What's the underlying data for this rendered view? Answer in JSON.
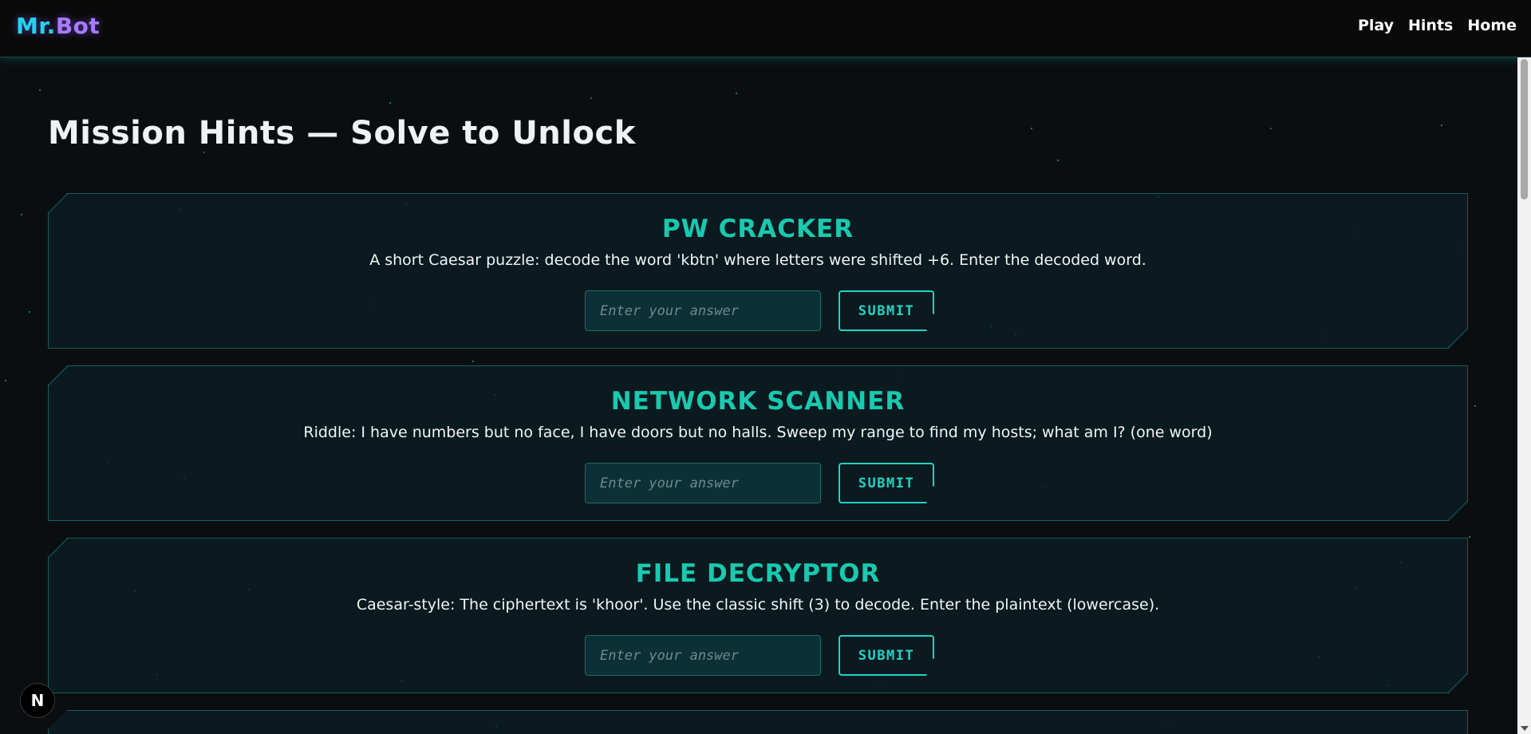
{
  "header": {
    "logo_part1": "Mr.",
    "logo_part2": "Bot",
    "nav": [
      {
        "label": "Play"
      },
      {
        "label": "Hints"
      },
      {
        "label": "Home"
      }
    ]
  },
  "page": {
    "title": "Mission Hints — Solve to Unlock"
  },
  "cards": [
    {
      "title": "PW CRACKER",
      "description": "A short Caesar puzzle: decode the word 'kbtn' where letters were shifted +6. Enter the decoded word.",
      "input_placeholder": "Enter your answer",
      "submit_label": "SUBMIT"
    },
    {
      "title": "NETWORK SCANNER",
      "description": "Riddle: I have numbers but no face, I have doors but no halls. Sweep my range to find my hosts; what am I? (one word)",
      "input_placeholder": "Enter your answer",
      "submit_label": "SUBMIT"
    },
    {
      "title": "FILE DECRYPTOR",
      "description": "Caesar-style: The ciphertext is 'khoor'. Use the classic shift (3) to decode. Enter the plaintext (lowercase).",
      "input_placeholder": "Enter your answer",
      "submit_label": "SUBMIT"
    }
  ],
  "dev_badge": "N",
  "colors": {
    "accent": "#19c9b0",
    "logo_cyan": "#22d3ee",
    "logo_purple": "#a67bff",
    "background": "#0b0e11"
  }
}
